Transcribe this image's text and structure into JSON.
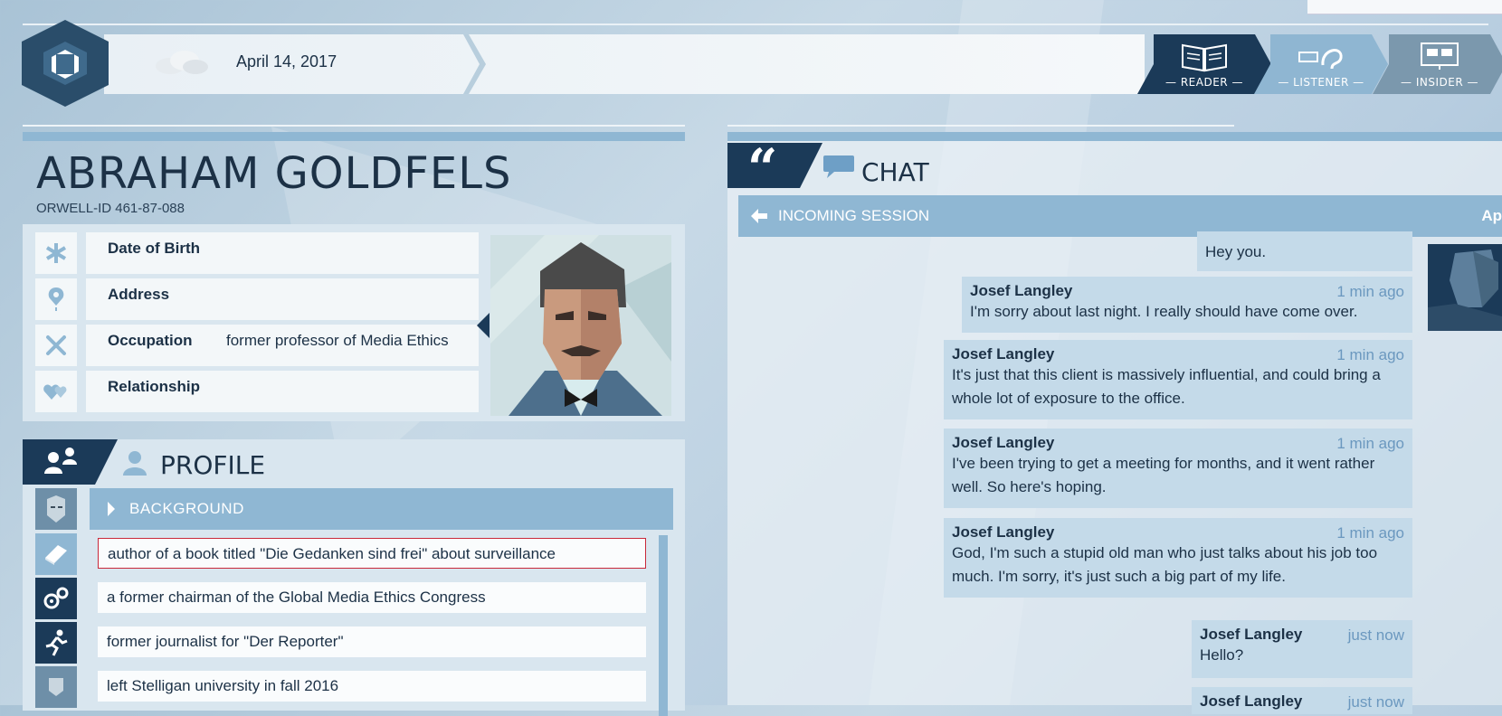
{
  "topbar": {
    "date": "April 14, 2017",
    "modes": [
      {
        "label": "— READER —",
        "icon": "book-icon"
      },
      {
        "label": "— LISTENER —",
        "icon": "ear-icon"
      },
      {
        "label": "— INSIDER —",
        "icon": "monitor-icon"
      }
    ]
  },
  "person": {
    "name": "ABRAHAM GOLDFELS",
    "orwell_id": "ORWELL-ID  461-87-088",
    "fields": [
      {
        "label": "Date of Birth",
        "value": "",
        "icon": "asterisk-icon"
      },
      {
        "label": "Address",
        "value": "",
        "icon": "location-pin-icon"
      },
      {
        "label": "Occupation",
        "value": "former professor of Media Ethics",
        "icon": "tools-icon"
      },
      {
        "label": "Relationship",
        "value": "",
        "icon": "hearts-icon"
      }
    ]
  },
  "profile": {
    "title": "PROFILE",
    "section": "BACKGROUND",
    "items": [
      "author of a book titled \"Die Gedanken sind frei\" about surveillance",
      "a former chairman of the Global Media Ethics Congress",
      "former journalist for \"Der Reporter\"",
      "left Stelligan university in fall 2016"
    ]
  },
  "chat": {
    "title": "CHAT",
    "session_label": "INCOMING SESSION",
    "session_right": "Ap",
    "messages": [
      {
        "name": "",
        "time": "",
        "text": "Hey you."
      },
      {
        "name": "Josef Langley",
        "time": "1 min ago",
        "text": "I'm sorry about last night. I really should have come over."
      },
      {
        "name": "Josef Langley",
        "time": "1 min ago",
        "text": "It's just that this client is massively influential, and could bring a whole lot of exposure to the office."
      },
      {
        "name": "Josef Langley",
        "time": "1 min ago",
        "text": "I've been trying to get a meeting for months, and it went rather well. So here's hoping."
      },
      {
        "name": "Josef Langley",
        "time": "1 min ago",
        "text": "God, I'm such a stupid old man who just talks about his job too much. I'm sorry, it's just such a big part of my life."
      },
      {
        "name": "Josef Langley",
        "time": "just now",
        "text": "Hello?"
      },
      {
        "name": "Josef Langley",
        "time": "just now",
        "text": ""
      }
    ]
  },
  "colors": {
    "dark_navy": "#1b3a58",
    "accent_blue": "#8fb7d3",
    "bubble": "#c4dae9",
    "selected_border": "#c8283a"
  }
}
